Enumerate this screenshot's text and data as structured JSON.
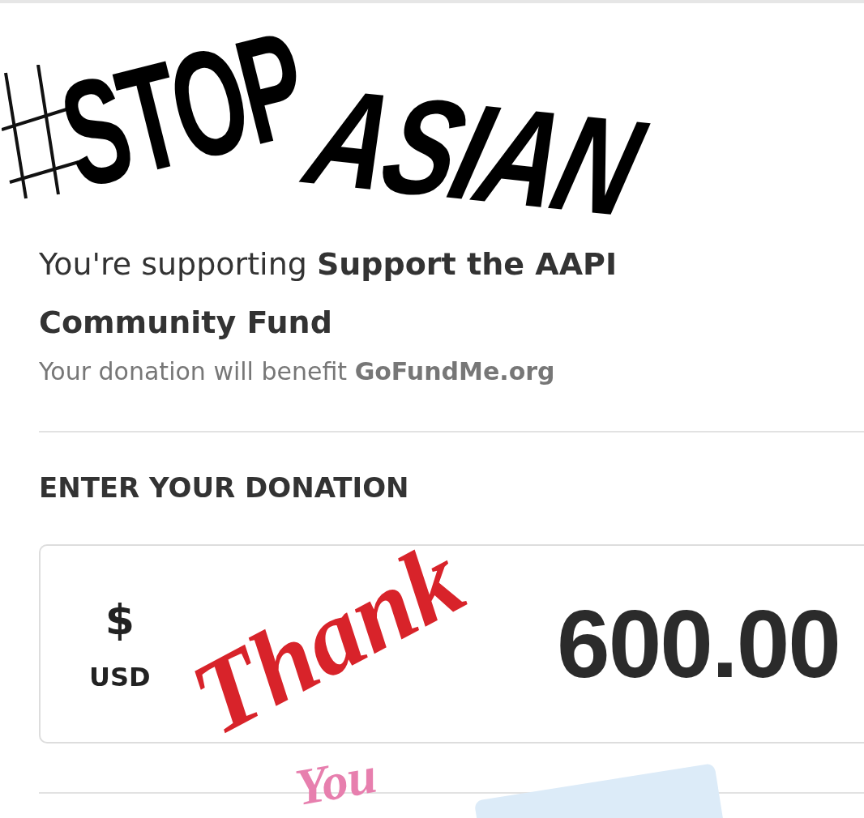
{
  "top_sticker": {
    "word_1": "STOP",
    "word_2": "ASIAN"
  },
  "supporting": "You're supporting **Support the AAPI Community Fund**",
  "benefit": "Your donation will benefit **GoFundMe.org**",
  "section_title": "ENTER YOUR DONATION",
  "amount_field": {
    "currency_symbol": "$",
    "currency_code": "USD",
    "value": "600.00"
  },
  "thank_you_sticker": {
    "line_1": "Thank",
    "line_2": "You"
  }
}
